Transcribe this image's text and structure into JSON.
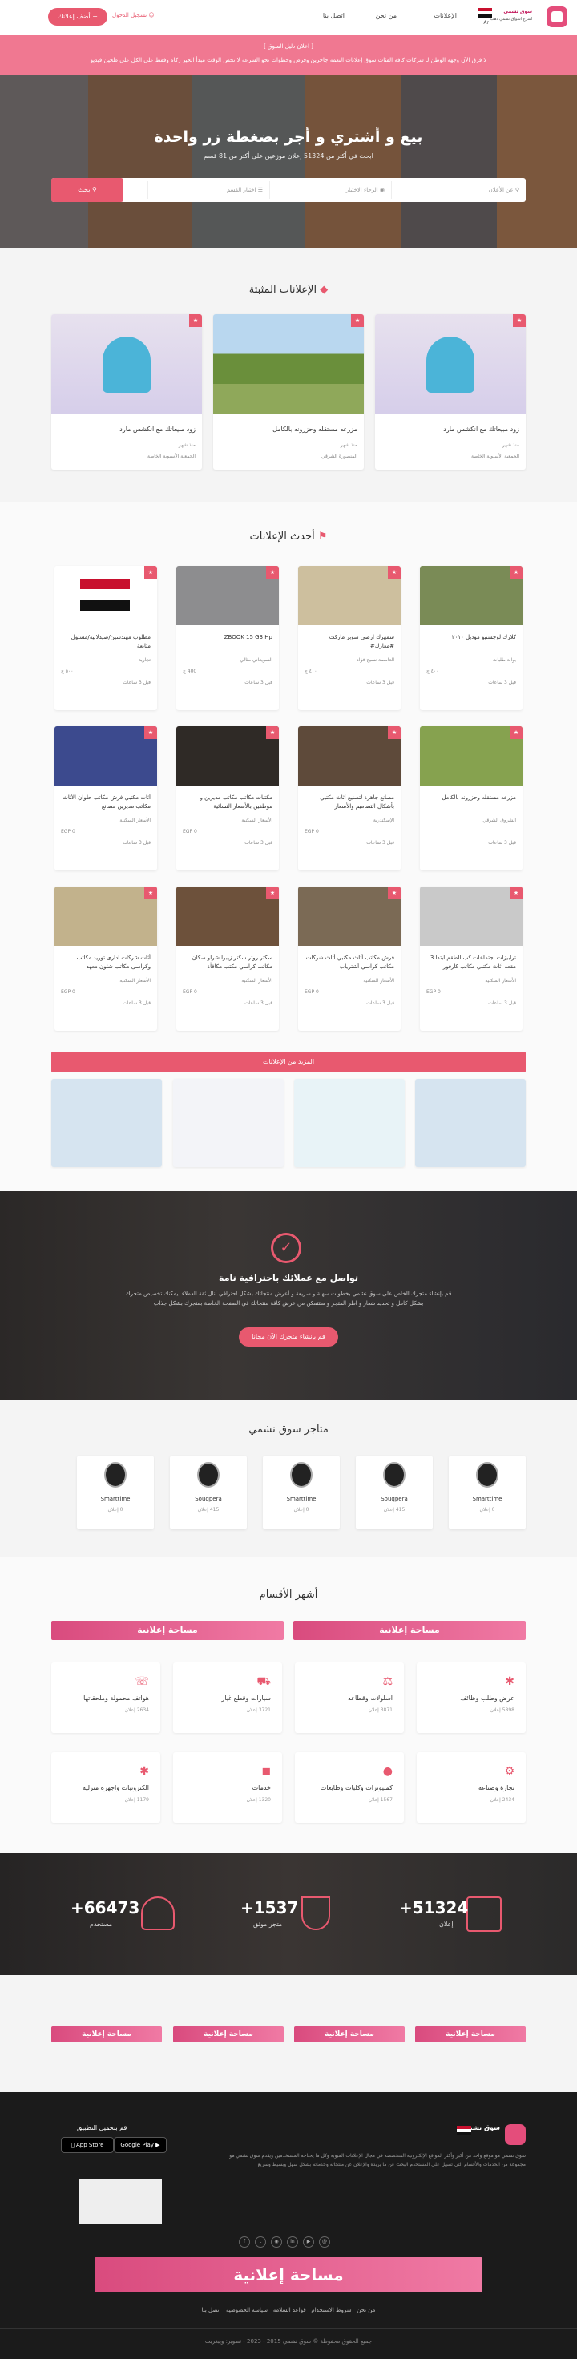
{
  "nav": {
    "logo_text": "سوق نشمي",
    "tagline": "اسرع اسواق نشمي دهب",
    "menu": [
      "الإعلانات",
      "من نحن",
      "اتصل بنا"
    ],
    "lang": "Ar",
    "login": "تسجيل الدخول",
    "add_ad": "أضف إعلانك"
  },
  "banner": {
    "line1": "[ اعلان دليل السوق ]",
    "line2": "لا فرق الآن وجهة الوطن لـ شركات كافة الفئات سوق إعلانات النعمة جاحزين وفرص وخطوات نحو السرعة لا تخص الوقت مبدأ الخير زكاة وفقط على الكل على طحين فيديو"
  },
  "hero": {
    "title": "بيع و أشتري و أجر بضغطة زر واحدة",
    "subtitle": "ابحث في أكثر من 51324 إعلان موزعين على أكثر من 81 قسم",
    "search": {
      "keyword": "عن الأعلان",
      "city": "الرجاء الاختيار",
      "category": "اختيار القسم",
      "button": "بحث"
    }
  },
  "featured": {
    "title": "الإعلانات المثبتة",
    "items": [
      {
        "title": "زود مبيعاتك مع انكشس مارد",
        "views": "منذ شهر",
        "location": "الجمعية الأسيوية الخاصة"
      },
      {
        "title": "مزرعه مستقله وحزرونه بالكامل",
        "views": "منذ شهر",
        "location": "المنصورة الشرقي"
      },
      {
        "title": "زود مبيعاتك مع انكشس مارد",
        "views": "منذ شهر",
        "location": "الجمعية الأسيوية الخاصة"
      }
    ]
  },
  "latest": {
    "title": "أحدث الإعلانات",
    "more": "المزيد من الإعلانات",
    "items": [
      {
        "title": "كلارك لوجستيو موديل ٢٠١٠",
        "price": "٤٠٠ ج",
        "loc": "بوابة طلبات",
        "time": "قبل 3 ساعات"
      },
      {
        "title": "شمهرك ارضي سوبر ماركت #معارك#",
        "price": "٤٠٠ ج",
        "loc": "العاصمة نسيج فؤاد",
        "time": "قبل 3 ساعات"
      },
      {
        "title": "ZBOOK 15 G3 Hp",
        "price": "400 ج",
        "loc": "السويعاني مثالي",
        "time": "قبل 3 ساعات"
      },
      {
        "title": "مطلوب مهندسين/صيدلانية/مسئول متابعة",
        "price": "٥٠٠ ج",
        "loc": "تجارية",
        "time": "قبل 3 ساعات"
      },
      {
        "title": "مزرعه مستقله وحزرونه بالكامل",
        "price": "",
        "loc": "الشروق الشرقي",
        "time": "قبل 3 ساعات"
      },
      {
        "title": "مصانع جاهزة لتصنيع أثاث مكتبي بأشكال التصاميم والأسعار",
        "price": "EGP 0",
        "loc": "الإسكندرية",
        "time": "قبل 3 ساعات"
      },
      {
        "title": "مكتبات مكاتب مكاتب مديرين و موظفين بالأسعار النسائية",
        "price": "EGP 0",
        "loc": "الأسعار السكنية",
        "time": "قبل 3 ساعات"
      },
      {
        "title": "أثاث مكتبي فرش مكاتب حلوان الأثاث مكاتب مديرين مصانع",
        "price": "EGP 0",
        "loc": "الأسعار السكنية",
        "time": "قبل 3 ساعات"
      },
      {
        "title": "ترابيزات اجتماعات كب الطقم ابتدا 3 مقعد أثاث مكتبي مكاتب كارفور",
        "price": "EGP 0",
        "loc": "الأسعار السكنية",
        "time": "قبل 3 ساعات"
      },
      {
        "title": "فرش مكاتب أثاث مكتبي أثاث شركات مكاتب كراسي أشترياب",
        "price": "EGP 0",
        "loc": "الأسعار السكنية",
        "time": "قبل 3 ساعات"
      },
      {
        "title": "سكتر روتر سكنر زيبرا شراو سكان مكاتب كراسي مكتب مكافأة",
        "price": "EGP 0",
        "loc": "الأسعار السكنية",
        "time": "قبل 3 ساعات"
      },
      {
        "title": "أثاث شركات ادارى توريد مكاتب وكراسى مكاتب شئون معهد",
        "price": "EGP 0",
        "loc": "الأسعار السكنية",
        "time": "قبل 3 ساعات"
      }
    ]
  },
  "cta": {
    "title": "تواصل مع عملائك باحترافية تامة",
    "text": "قم بإنشاء متجرك الخاص على سوق نشمي بخطوات سهلة و سريعة و أعرض منتجاتك بشكل احترافي أنال ثقة العملاء. يمكنك تخصيص متجرك بشكل كامل و تحديد شعار و اطر المتجر و ستتمكن من عرض كافة منتجاتك في الصفحة الخاصة بمتجرك بشكل جذاب",
    "button": "قم بإنشاء متجرك الآن مجانا"
  },
  "stores": {
    "title": "متاجر سوق نشمي",
    "items": [
      {
        "name": "Smarttime",
        "count": "0 إعلان"
      },
      {
        "name": "Souqpera",
        "count": "415 إعلان"
      },
      {
        "name": "Smarttime",
        "count": "0 إعلان"
      },
      {
        "name": "Souqpera",
        "count": "415 إعلان"
      },
      {
        "name": "Smarttime",
        "count": "0 إعلان"
      }
    ]
  },
  "categories": {
    "title": "أشهر الأقسام",
    "ad_text": "مساحة إعلانية",
    "items": [
      {
        "name": "عرض وطلب وظائف",
        "count": "5898 إعلان",
        "icon": "asterisk-icon"
      },
      {
        "name": "اسلولات وقطاعه",
        "count": "3871 إعلان",
        "icon": "scale-icon"
      },
      {
        "name": "سيارات وقطع غيار",
        "count": "3721 إعلان",
        "icon": "car-icon"
      },
      {
        "name": "هواتف محمولة وملحقاتها",
        "count": "2634 إعلان",
        "icon": "phone-icon"
      },
      {
        "name": "تجارة وصناعه",
        "count": "2434 إعلان",
        "icon": "gear-icon"
      },
      {
        "name": "كمبيوترات وكلبات وطابعات",
        "count": "1567 إعلان",
        "icon": "apple-icon"
      },
      {
        "name": "خدمات",
        "count": "1320 إعلان",
        "icon": "megaphone-icon"
      },
      {
        "name": "الكترونيات واجهزه منزليه",
        "count": "1179 إعلان",
        "icon": "asterisk-icon"
      }
    ]
  },
  "stats": [
    {
      "value": "+51324",
      "label": "إعلان"
    },
    {
      "value": "+1537",
      "label": "متجر موثق"
    },
    {
      "value": "+66473",
      "label": "مستخدم"
    }
  ],
  "ads_row": {
    "text": "مساحة إعلانية"
  },
  "footer": {
    "about": "سوق نشمي هو موقع واحد من أكبر وأكثر المواقع الإلكترونية المتخصصة في مجال الإعلانات المبوبة وكل ما يحتاجه المستخدمين ويقدم سوق نشمي هو مجموعة من الخدمات والأقسام التي تسهل على المستخدم البحث عن ما يريده والإعلان عن منتجاته وخدماته بشكل سهل وبسيط وسريع",
    "app_title": "قم بتحميل التطبيق",
    "app_store": "App Store",
    "google_play": "Google Play",
    "links": [
      "من نحن",
      "شروط الاستخدام",
      "قواعد السلامة",
      "سياسة الخصوصية",
      "اتصل بنا"
    ],
    "copyright": "جميع الحقوق محفوظة © سوق نشمي 2015 - 2023 - تطوير: ويبغريت",
    "ad_text": "مساحة إعلانية"
  },
  "colors": {
    "accent": "#e8596f",
    "dark": "#2e2b2a",
    "footer": "#1b1b1b"
  }
}
